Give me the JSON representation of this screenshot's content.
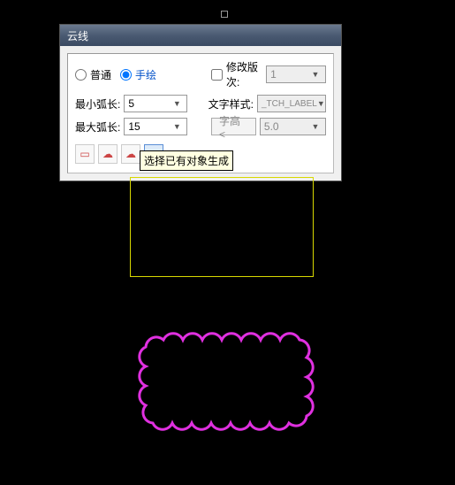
{
  "dialog": {
    "title": "云线",
    "radio_normal": "普通",
    "radio_hand": "手绘",
    "chk_rev": "修改版次:",
    "rev_value": "1",
    "min_arc_label": "最小弧长:",
    "min_arc_value": "5",
    "text_style_label": "文字样式:",
    "text_style_value": "_TCH_LABEL",
    "max_arc_label": "最大弧长:",
    "max_arc_value": "15",
    "height_btn": "字高 <",
    "height_value": "5.0"
  },
  "tooltip": "选择已有对象生成"
}
